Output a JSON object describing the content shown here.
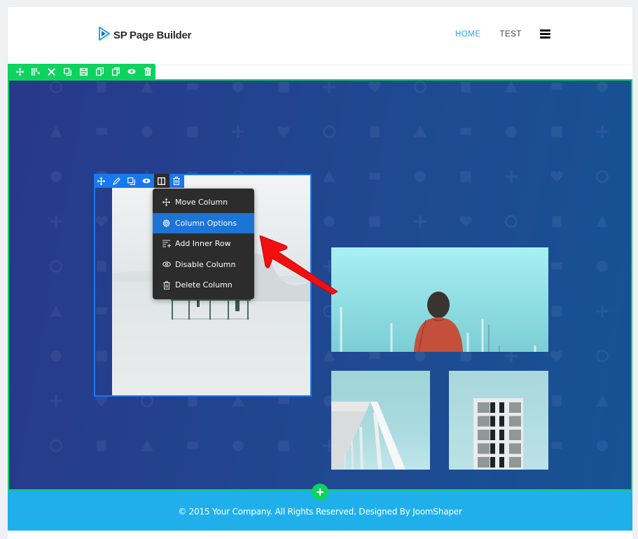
{
  "header": {
    "logo_text": "SP Page Builder",
    "nav": [
      {
        "label": "HOME",
        "active": true
      },
      {
        "label": "TEST",
        "active": false
      }
    ],
    "menu_icon": "hamburger-icon"
  },
  "section_toolbar": {
    "icons": [
      "move-icon",
      "columns-add-icon",
      "settings-tools-icon",
      "duplicate-icon",
      "save-icon",
      "copy-icon",
      "paste-icon",
      "visibility-eye-icon",
      "trash-icon"
    ]
  },
  "column_toolbar": {
    "icons": [
      "move-icon",
      "edit-pencil-icon",
      "duplicate-icon",
      "visibility-eye-icon",
      "column-layout-icon",
      "trash-icon"
    ],
    "active_icon": "column-layout-icon"
  },
  "column_menu": {
    "items": [
      {
        "label": "Move Column",
        "icon": "move-icon",
        "active": false
      },
      {
        "label": "Column Options",
        "icon": "gear-icon",
        "active": true
      },
      {
        "label": "Add Inner Row",
        "icon": "add-row-icon",
        "active": false
      },
      {
        "label": "Disable Column",
        "icon": "eye-icon",
        "active": false
      },
      {
        "label": "Delete Column",
        "icon": "trash-icon",
        "active": false
      }
    ]
  },
  "images": [
    {
      "subject": "misty-lake-structure"
    },
    {
      "subject": "man-red-jacket-headphones"
    },
    {
      "subject": "white-building-columns"
    },
    {
      "subject": "building-windows-facade"
    }
  ],
  "add_row_button": {
    "icon": "plus-icon"
  },
  "footer": {
    "text": "© 2015 Your Company. All Rights Reserved. Designed By JoomShaper"
  },
  "colors": {
    "builder_green": "#0ed45f",
    "column_blue": "#1878f0",
    "menu_dark": "#2c2c2c",
    "menu_active": "#1c74d6",
    "footer_blue": "#1fb0ec",
    "nav_active": "#22a7e0",
    "annotation_arrow": "#f01010"
  }
}
